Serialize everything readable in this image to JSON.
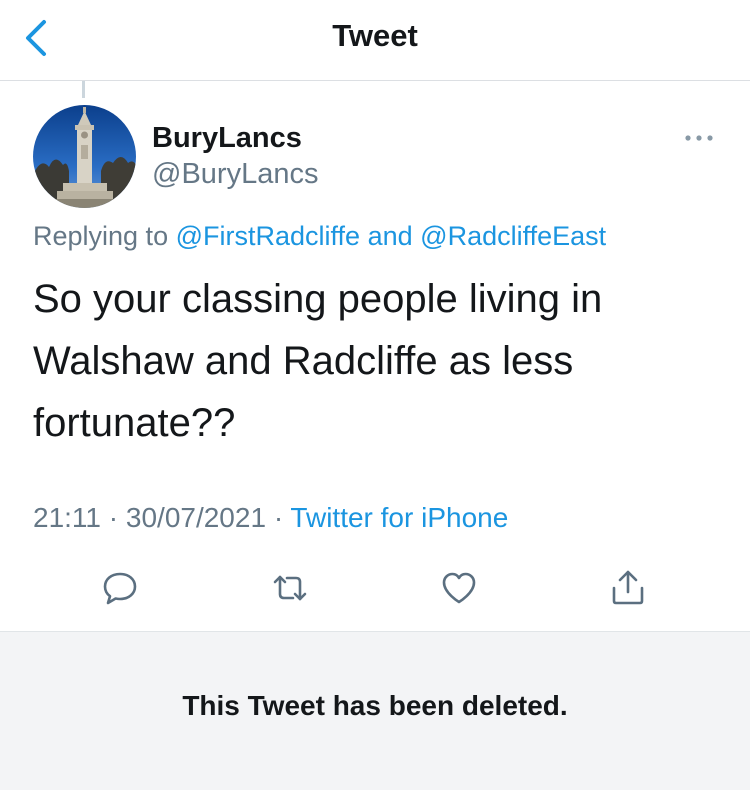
{
  "header": {
    "title": "Tweet",
    "back_icon": "chevron-left-icon"
  },
  "tweet": {
    "display_name": "BuryLancs",
    "handle": "@BuryLancs",
    "replying_prefix": "Replying to",
    "reply_to_1": "@FirstRadcliffe",
    "reply_joiner": "and",
    "reply_to_2": "@RadcliffeEast",
    "text": "So your classing people living in Walshaw and Radcliffe as less fortunate??",
    "time": "21:11",
    "date": "30/07/2021",
    "separator": "·",
    "source": "Twitter for iPhone",
    "more_icon": "more-horizontal-icon"
  },
  "actions": [
    {
      "name": "reply",
      "icon": "comment-icon"
    },
    {
      "name": "retweet",
      "icon": "retweet-icon"
    },
    {
      "name": "like",
      "icon": "heart-icon"
    },
    {
      "name": "share",
      "icon": "share-icon"
    }
  ],
  "deleted_notice": "This Tweet has been deleted.",
  "colors": {
    "accent": "#1b95e0",
    "text": "#14171a",
    "secondary": "#657786",
    "panel": "#f3f4f6"
  }
}
